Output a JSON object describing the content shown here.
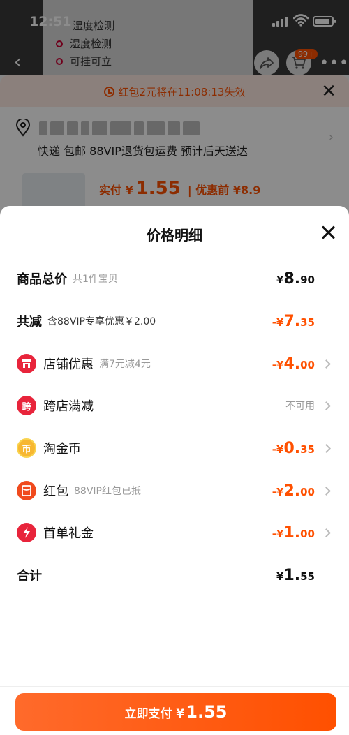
{
  "status": {
    "time": "12:51"
  },
  "background": {
    "specs": [
      "湿度检测",
      "湿度检测",
      "可挂可立"
    ],
    "cart_badge": "99+",
    "coupon_notice": "红包2元将在11:08:13失效",
    "address_line": "快递 包邮 88VIP退货包运费 预计后天送达",
    "price_label": "实付 ¥",
    "price_value": "1.55",
    "price_before": "| 优惠前 ¥8.9"
  },
  "modal": {
    "title": "价格明细",
    "rows": [
      {
        "label": "商品总价",
        "sub": "共1件宝贝",
        "value_cur": "¥",
        "value_int": "8.",
        "value_dec": "90"
      },
      {
        "label": "共减",
        "sub": "含88VIP专享优惠￥2.00",
        "value_cur": "-¥",
        "value_int": "7.",
        "value_dec": "35"
      },
      {
        "label": "店铺优惠",
        "sub": "满7元减4元",
        "value_cur": "-¥",
        "value_int": "4.",
        "value_dec": "00"
      },
      {
        "label": "跨店满减",
        "sub": "",
        "value_text": "不可用"
      },
      {
        "label": "淘金币",
        "sub": "",
        "value_cur": "-¥",
        "value_int": "0.",
        "value_dec": "35"
      },
      {
        "label": "红包",
        "sub": "88VIP红包已抵",
        "value_cur": "-¥",
        "value_int": "2.",
        "value_dec": "00"
      },
      {
        "label": "首单礼金",
        "sub": "",
        "value_cur": "-¥",
        "value_int": "1.",
        "value_dec": "00"
      },
      {
        "label": "合计",
        "sub": "",
        "value_cur": "¥",
        "value_int": "1.",
        "value_dec": "55"
      }
    ],
    "icon_glyphs": {
      "cross_store": "跨",
      "coin": "币"
    }
  },
  "pay": {
    "label": "立即支付 ¥",
    "amount": "1.55"
  },
  "colors": {
    "accent": "#ff5000",
    "icon_red": "#e8243b",
    "icon_gold": "#f7b731"
  }
}
